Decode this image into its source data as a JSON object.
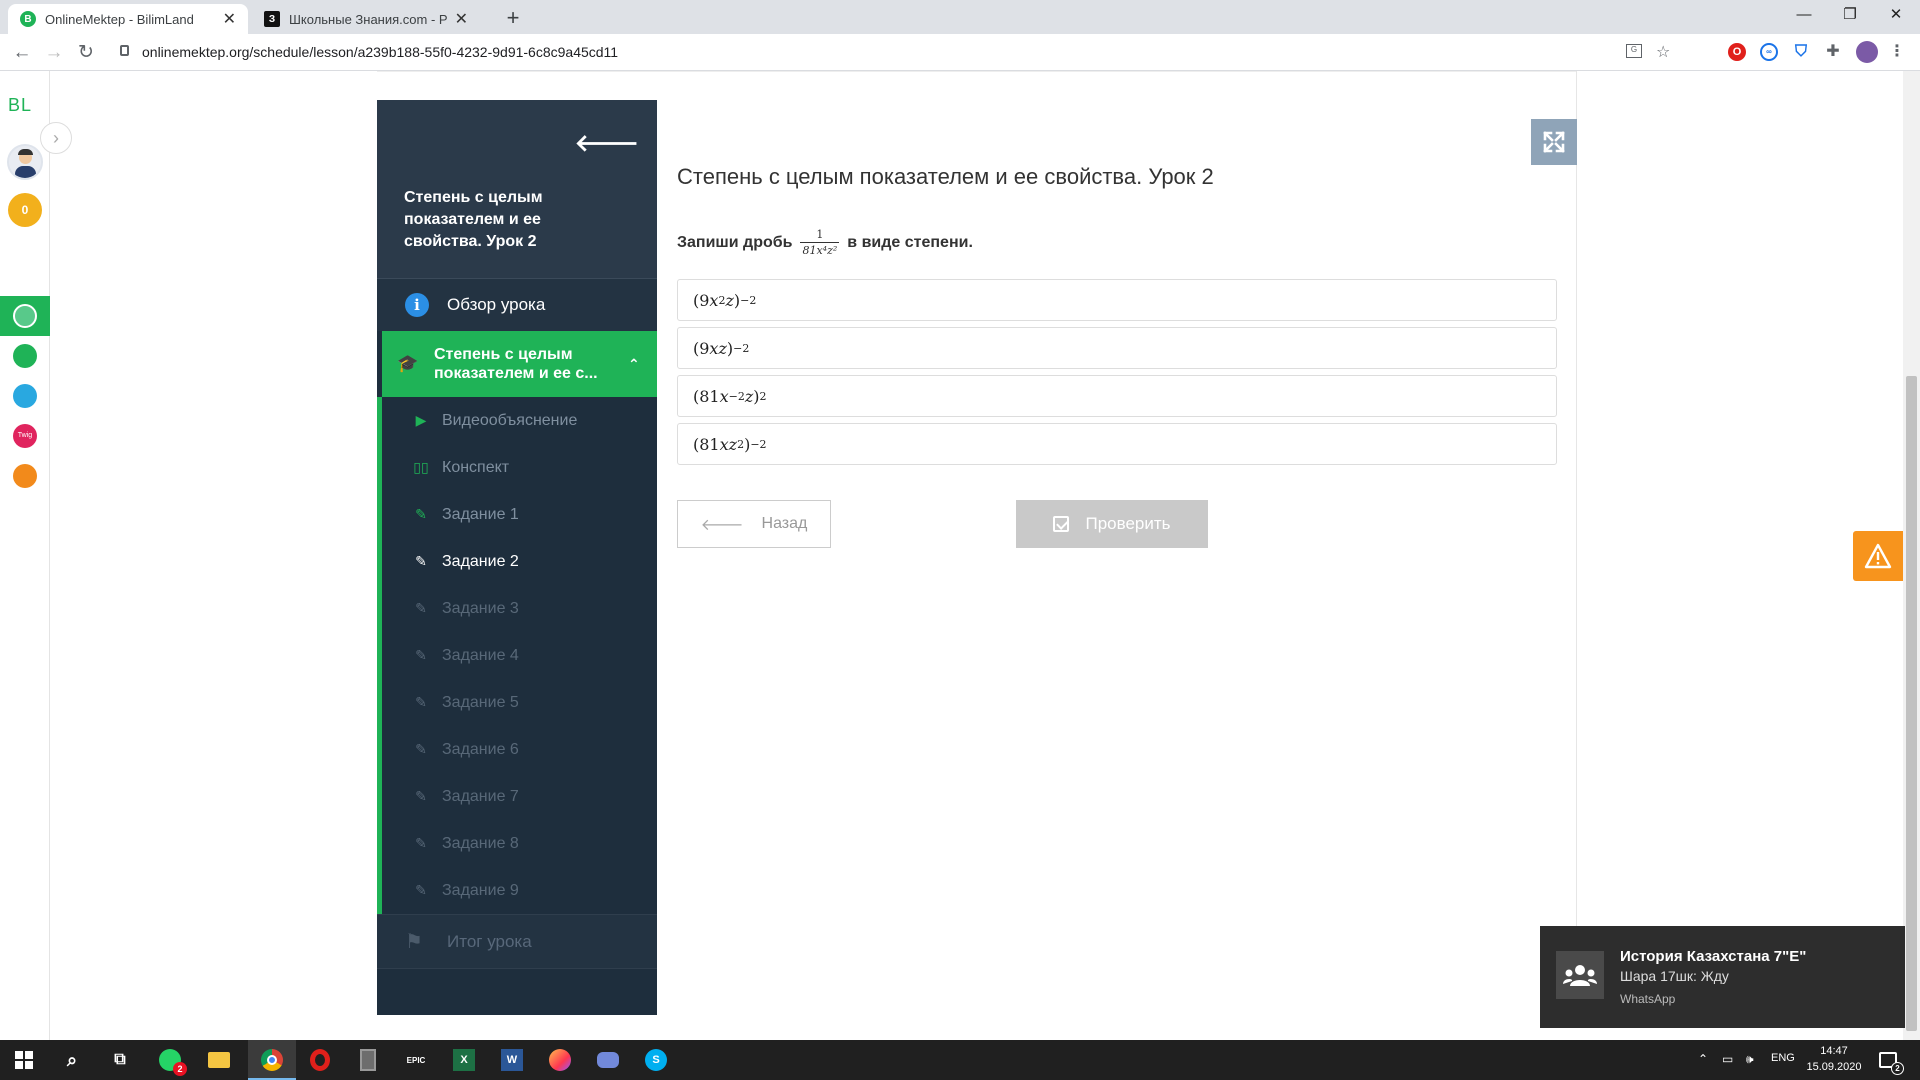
{
  "browser": {
    "tabs": [
      {
        "title": "OnlineMektep - BilimLand",
        "favicon": "bilimland-favicon",
        "active": true
      },
      {
        "title": "Школьные Знания.com - Решае",
        "favicon": "znania-favicon",
        "active": false
      }
    ],
    "url": "onlinemektep.org/schedule/lesson/a239b188-55f0-4232-9d91-6c8c9a45cd11"
  },
  "rail": {
    "logo": "BL",
    "coins": "0",
    "apps": [
      "online-mektep",
      "bilimland",
      "daryn",
      "twig",
      "imektep"
    ]
  },
  "lesson_nav": {
    "title": "Степень с целым показателем и ее свойства. Урок 2",
    "overview": "Обзор урока",
    "section": "Степень с целым показателем и ее с...",
    "items": [
      {
        "label": "Видеообъяснение",
        "icon": "play-icon",
        "state": "done"
      },
      {
        "label": "Конспект",
        "icon": "book-icon",
        "state": "done"
      },
      {
        "label": "Задание 1",
        "icon": "edit-icon",
        "state": "done"
      },
      {
        "label": "Задание 2",
        "icon": "edit-icon",
        "state": "current"
      },
      {
        "label": "Задание 3",
        "icon": "edit-icon",
        "state": "locked"
      },
      {
        "label": "Задание 4",
        "icon": "edit-icon",
        "state": "locked"
      },
      {
        "label": "Задание 5",
        "icon": "edit-icon",
        "state": "locked"
      },
      {
        "label": "Задание 6",
        "icon": "edit-icon",
        "state": "locked"
      },
      {
        "label": "Задание 7",
        "icon": "edit-icon",
        "state": "locked"
      },
      {
        "label": "Задание 8",
        "icon": "edit-icon",
        "state": "locked"
      },
      {
        "label": "Задание 9",
        "icon": "edit-icon",
        "state": "locked"
      }
    ],
    "result": "Итог урока"
  },
  "main": {
    "title": "Степень с целым показателем и ее свойства. Урок 2",
    "question_before": "Запиши дробь",
    "fraction": {
      "numerator": "1",
      "denominator": "81x⁴z²"
    },
    "question_after": "в виде степени.",
    "options": [
      {
        "base": "(9",
        "var1": "x",
        "exp1": "2",
        "var2": "z",
        "close": ")",
        "exp": "−2"
      },
      {
        "base": "(9",
        "var1": "xz",
        "exp1": "",
        "var2": "",
        "close": ")",
        "exp": "−2"
      },
      {
        "base": "(81",
        "var1": "x",
        "exp1": "−2",
        "var2": "z",
        "close": ")",
        "exp": "2"
      },
      {
        "base": "(81",
        "var1": "xz",
        "exp1": "2",
        "var2": "",
        "close": ")",
        "exp": "−2"
      }
    ],
    "back_label": "Назад",
    "check_label": "Проверить"
  },
  "notification": {
    "title": "История Казахстана 7\"E\"",
    "message": "Шара 17шк: Жду",
    "app": "WhatsApp"
  },
  "taskbar": {
    "whatsapp_badge": "2",
    "lang": "ENG",
    "time": "14:47",
    "date": "15.09.2020",
    "notif_count": "2"
  },
  "colors": {
    "accent_green": "#1fb357",
    "nav_dark": "#1e2e3d",
    "warning_orange": "#f7941d"
  }
}
